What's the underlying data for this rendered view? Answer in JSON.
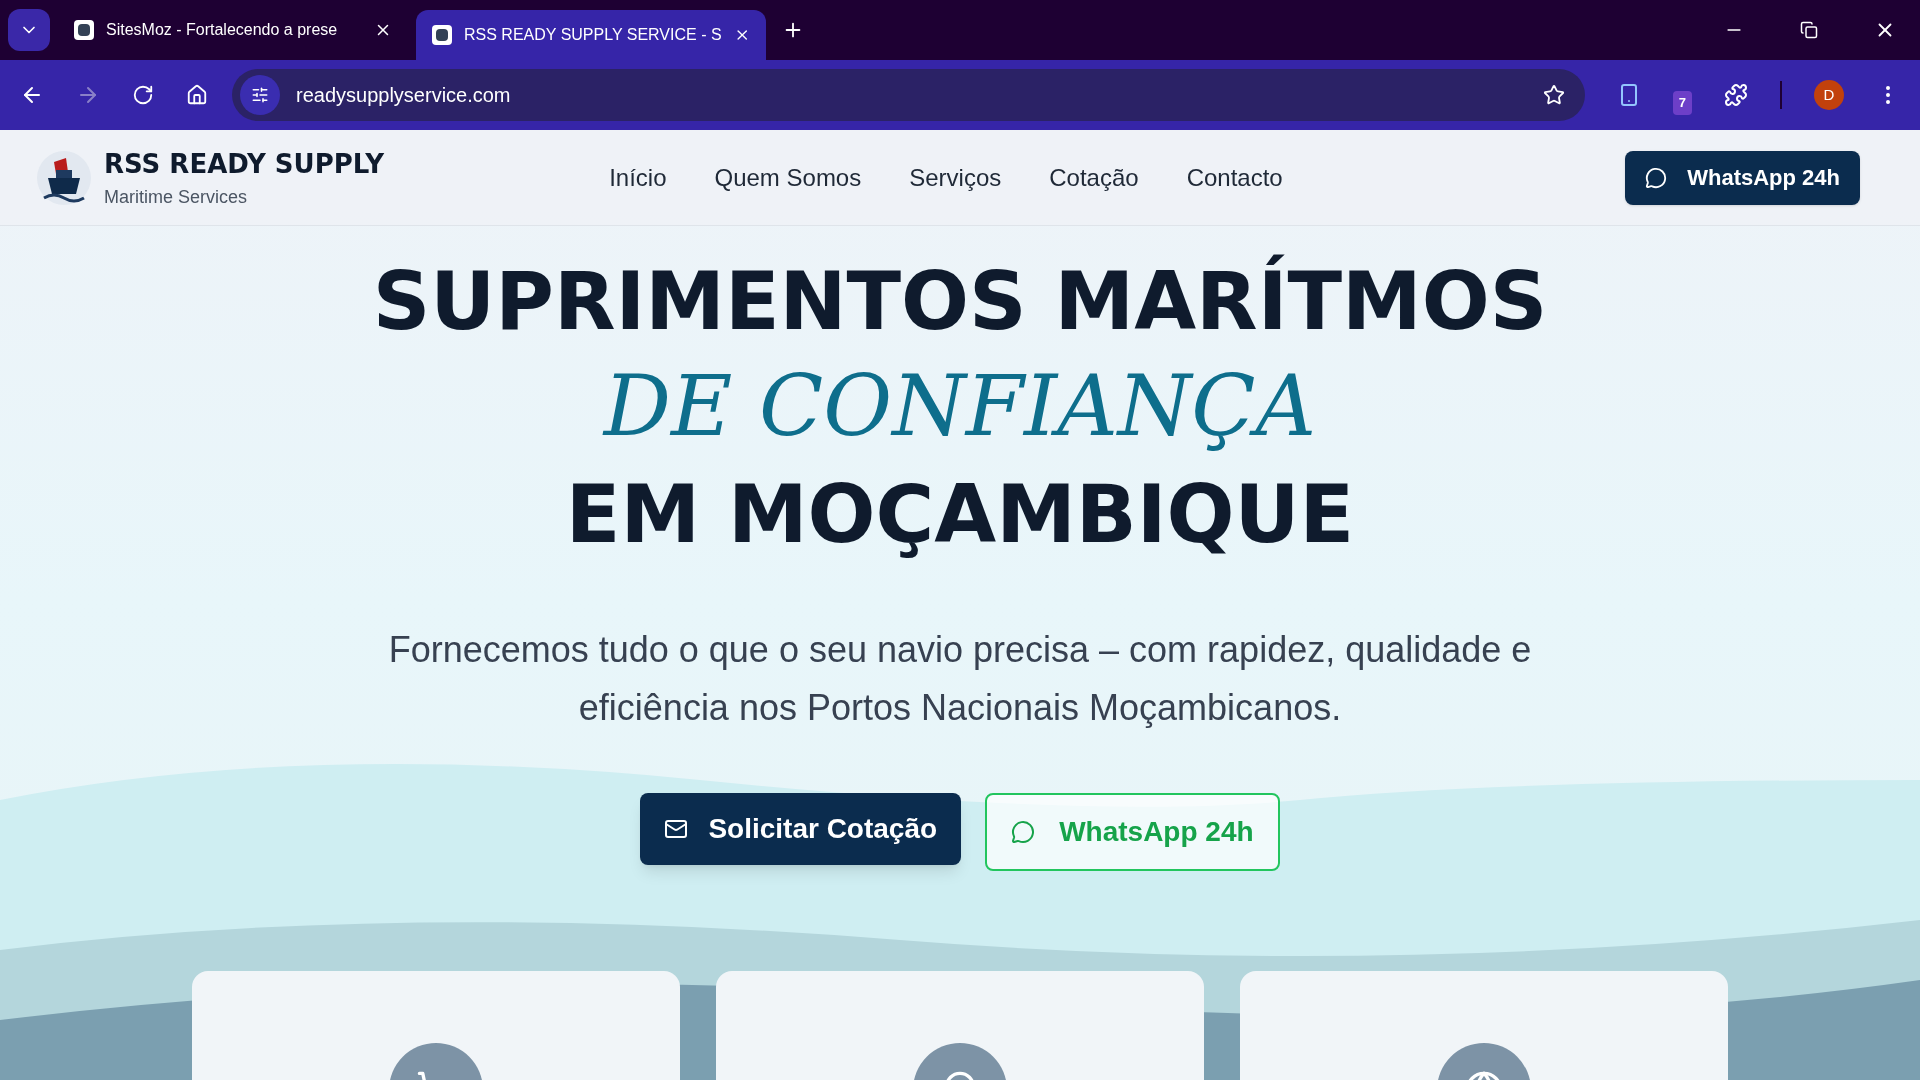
{
  "browser": {
    "tabs": [
      {
        "title": "SitesMoz - Fortalecendo a prese",
        "selected": false
      },
      {
        "title": "RSS READY SUPPLY SERVICE - S",
        "selected": true
      }
    ],
    "address": "readysupplyservice.com",
    "extension_badge": "7",
    "profile_initial": "D"
  },
  "header": {
    "brand": "RSS READY SUPPLY",
    "tagline": "Maritime Services",
    "nav": [
      {
        "label": "Início"
      },
      {
        "label": "Quem Somos"
      },
      {
        "label": "Serviços"
      },
      {
        "label": "Cotação"
      },
      {
        "label": "Contacto"
      }
    ],
    "cta": "WhatsApp 24h"
  },
  "hero": {
    "title_top": "SUPRIMENTOS MARÍTMOS",
    "title_script": "DE CONFIANÇA",
    "title_bottom": "EM MOÇAMBIQUE",
    "subtitle": "Fornecemos tudo o que o seu navio precisa – com rapidez, qualidade e eficiência nos Portos Nacionais Moçambicanos.",
    "buttons": [
      {
        "kind": "primary",
        "label": "Solicitar Cotação"
      },
      {
        "kind": "outline",
        "label": "WhatsApp 24h"
      }
    ]
  },
  "cards": [
    {
      "kind": "cart"
    },
    {
      "kind": "pin"
    },
    {
      "kind": "globe"
    }
  ]
}
